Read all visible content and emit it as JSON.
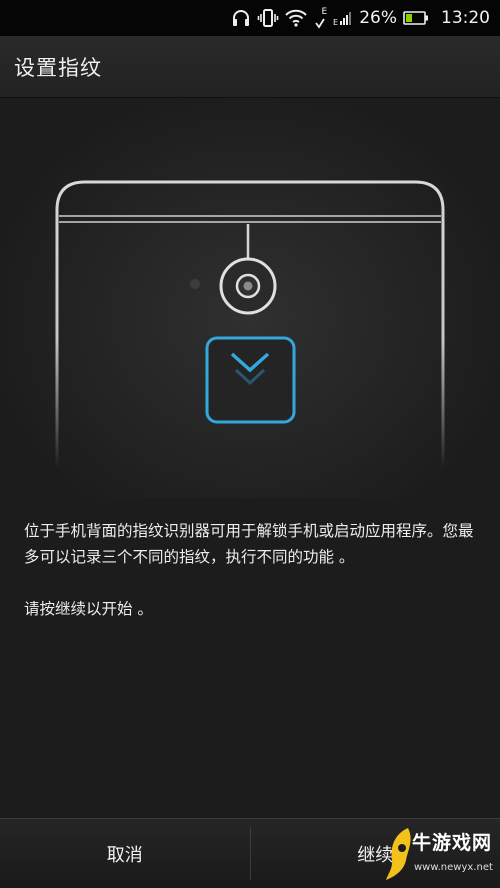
{
  "status_bar": {
    "icons": [
      "headphones-icon",
      "vibrate-icon",
      "wifi-icon",
      "data-arrows-icon",
      "signal-icon",
      "battery-icon"
    ],
    "network_label": "E",
    "battery_text": "26%",
    "time": "13:20"
  },
  "header": {
    "title": "设置指纹"
  },
  "description": {
    "paragraph_1": "位于手机背面的指纹识别器可用于解锁手机或启动应用程序。您最多可以记录三个不同的指纹，执行不同的功能 。",
    "paragraph_2": "请按继续以开始 。"
  },
  "actions": {
    "cancel": "取消",
    "continue": "继续"
  },
  "watermark": {
    "title": "牛游戏网",
    "url": "www.newyx.net"
  },
  "colors": {
    "accent": "#33a8dc",
    "background": "#1c1c1c",
    "watermark_yellow": "#f2c21b"
  }
}
